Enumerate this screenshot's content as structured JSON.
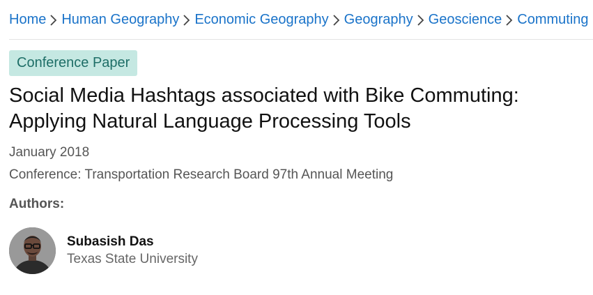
{
  "breadcrumb": {
    "items": [
      {
        "label": "Home"
      },
      {
        "label": "Human Geography"
      },
      {
        "label": "Economic Geography"
      },
      {
        "label": "Geography"
      },
      {
        "label": "Geoscience"
      },
      {
        "label": "Commuting"
      }
    ]
  },
  "publication": {
    "type_badge": "Conference Paper",
    "title": "Social Media Hashtags associated with Bike Commuting: Applying Natural Language Processing Tools",
    "date": "January 2018",
    "conference": "Conference: Transportation Research Board 97th Annual Meeting",
    "authors_heading": "Authors:"
  },
  "authors": [
    {
      "name": "Subasish Das",
      "affiliation": "Texas State University",
      "avatar_icon": "author-photo"
    }
  ],
  "colors": {
    "link": "#1a73c9",
    "badge_bg": "#c5e8e2",
    "badge_text": "#1e6e67",
    "muted_text": "#555555"
  }
}
